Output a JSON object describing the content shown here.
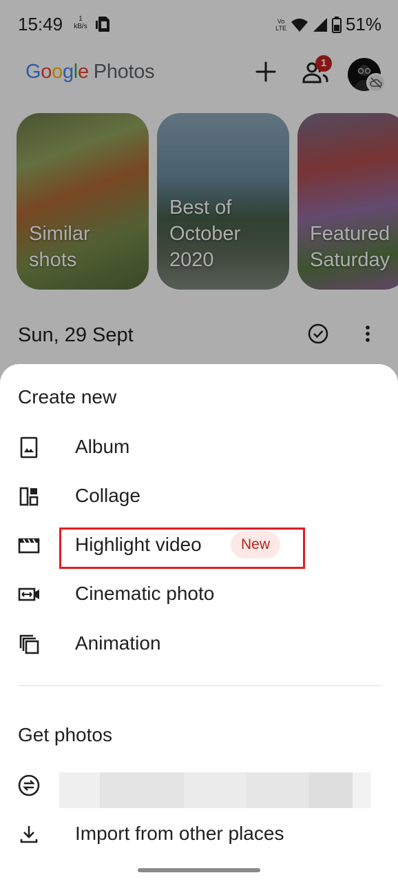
{
  "status_bar": {
    "time": "15:49",
    "net_speed_value": "1",
    "net_speed_unit": "kB/s",
    "volte_top": "Vo",
    "volte_mid": "LTE",
    "battery": "51%"
  },
  "header": {
    "logo_google": [
      "G",
      "o",
      "o",
      "g",
      "l",
      "e"
    ],
    "logo_photos": "Photos",
    "notification_count": "1"
  },
  "memories": [
    {
      "label": "Similar\nshots"
    },
    {
      "label": "Best of\nOctober\n2020"
    },
    {
      "label": "Featured\nSaturday"
    }
  ],
  "date_header": "Sun, 29 Sept",
  "create_sheet": {
    "create_title": "Create new",
    "create_items": [
      {
        "label": "Album",
        "icon": "album-icon"
      },
      {
        "label": "Collage",
        "icon": "collage-icon"
      },
      {
        "label": "Highlight video",
        "icon": "clapperboard-icon",
        "chip": "New"
      },
      {
        "label": "Cinematic photo",
        "icon": "cinematic-icon"
      },
      {
        "label": "Animation",
        "icon": "animation-icon"
      }
    ],
    "get_title": "Get photos",
    "get_items": [
      {
        "label": "",
        "icon": "sync-icon"
      },
      {
        "label": "Import from other places",
        "icon": "download-icon"
      }
    ]
  },
  "colors": {
    "highlight_box": "#e31b23",
    "new_chip_bg": "#fce8e6",
    "new_chip_text": "#b3261e",
    "badge": "#c5221f"
  }
}
